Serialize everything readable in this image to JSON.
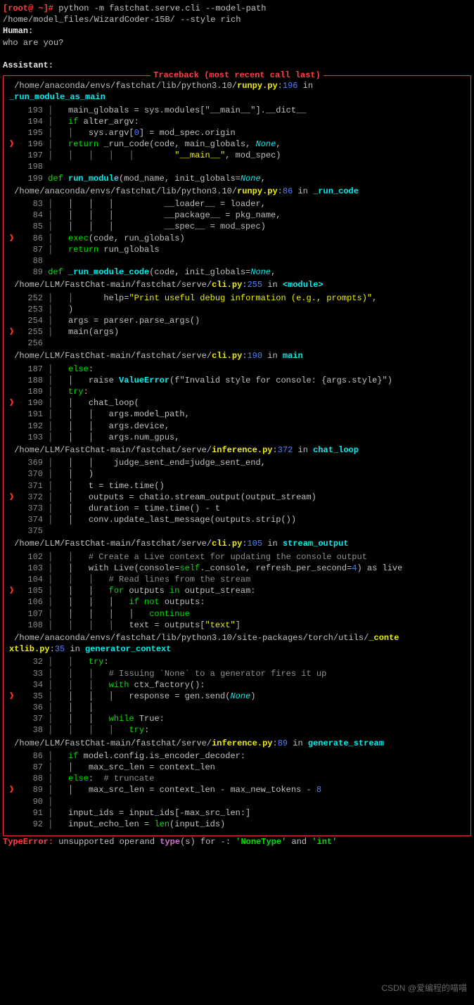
{
  "prompt": {
    "user_host": "[root@ ~]#",
    "cmd1": " python -m fastchat.serve.cli --model-path",
    "cmd2": "/home/model_files/WizardCoder-15B/ --style rich"
  },
  "labels": {
    "human": "Human:",
    "assistant": "Assistant:"
  },
  "human_input": "who are you?",
  "tb_title": "Traceback (most recent call last)",
  "loc1": {
    "path": "/home/anaconda/envs/fastchat/lib/python3.10/",
    "file": "runpy.py",
    "line": "196",
    "in": " in",
    "fn": "_run_module_as_main"
  },
  "code1": {
    "l193": "   main_globals = sys.modules[\"__main__\"].__dict__",
    "l194": "   if alter_argv:",
    "l195": "   │   sys.argv[0] = mod_spec.origin",
    "l196": "   return _run_code(code, main_globals, None,",
    "l197": "   │   │   │   │        \"__main__\", mod_spec)",
    "l198": "",
    "l199_a": "def ",
    "l199_b": "run_module",
    "l199_c": "(mod_name, init_globals=",
    "l199_d": "None",
    "l199_e": ","
  },
  "loc2": {
    "path": "/home/anaconda/envs/fastchat/lib/python3.10/",
    "file": "runpy.py",
    "line": "86",
    "in": " in ",
    "fn": "_run_code"
  },
  "code2": {
    "l83": "   │   │   │          __loader__ = loader,",
    "l84": "   │   │   │          __package__ = pkg_name,",
    "l85": "   │   │   │          __spec__ = mod_spec)",
    "l86": "   exec(code, run_globals)",
    "l87": "   return run_globals",
    "l88": "",
    "l89_a": "def ",
    "l89_b": "_run_module_code",
    "l89_c": "(code, init_globals=",
    "l89_d": "None",
    "l89_e": ","
  },
  "loc3": {
    "path": "/home/LLM/FastChat-main/fastchat/serve/",
    "file": "cli.py",
    "line": "255",
    "in": " in ",
    "fn": "<module>"
  },
  "code3": {
    "l252": "   │      help=\"Print useful debug information (e.g., prompts)\",",
    "l253": "   )",
    "l254": "   args = parser.parse_args()",
    "l255": "   main(args)",
    "l256": ""
  },
  "loc4": {
    "path": "/home/LLM/FastChat-main/fastchat/serve/",
    "file": "cli.py",
    "line": "190",
    "in": " in ",
    "fn": "main"
  },
  "code4": {
    "l187": "   else:",
    "l188a": "   │   raise ",
    "l188b": "ValueError",
    "l188c": "(f\"Invalid style for console: {args.style}\")",
    "l189": "   try:",
    "l190": "   │   chat_loop(",
    "l191": "   │   │   args.model_path,",
    "l192": "   │   │   args.device,",
    "l193": "   │   │   args.num_gpus,"
  },
  "loc5": {
    "path": "/home/LLM/FastChat-main/fastchat/serve/",
    "file": "inference.py",
    "line": "372",
    "in": " in ",
    "fn": "chat_loop"
  },
  "code5": {
    "l369": "   │   │    judge_sent_end=judge_sent_end,",
    "l370": "   │   )",
    "l371": "   │   t = time.time()",
    "l372": "   │   outputs = chatio.stream_output(output_stream)",
    "l373": "   │   duration = time.time() - t",
    "l374": "   │   conv.update_last_message(outputs.strip())",
    "l375": ""
  },
  "loc6": {
    "path": "/home/LLM/FastChat-main/fastchat/serve/",
    "file": "cli.py",
    "line": "105",
    "in": " in ",
    "fn": "stream_output"
  },
  "code6": {
    "l102": "   │   # Create a Live context for updating the console output",
    "l103a": "   │   with Live(console=",
    "l103b": "self",
    "l103c": "._console, refresh_per_second=",
    "l103d": "4",
    "l103e": ") as live",
    "l104": "   │   │   # Read lines from the stream",
    "l105a": "   │   │   ",
    "l105b": "for",
    "l105c": " outputs ",
    "l105d": "in",
    "l105e": " output_stream:",
    "l106a": "   │   │   │   ",
    "l106b": "if not",
    "l106c": " outputs:",
    "l107a": "   │   │   │   │   ",
    "l107b": "continue",
    "l108": "   │   │   │   text = outputs[\"text\"]"
  },
  "loc7": {
    "path": "/home/anaconda/envs/fastchat/lib/python3.10/site-packages/torch/utils/",
    "file": "_contextlib.py",
    "line": "35",
    "in": " in ",
    "fn": "generator_context"
  },
  "code7": {
    "l32": "   │   try:",
    "l33": "   │   │   # Issuing `None` to a generator fires it up",
    "l34": "   │   │   with ctx_factory():",
    "l35a": "   │   │   │   response = gen.send(",
    "l35b": "None",
    "l35c": ")",
    "l36": "   │   │   ",
    "l37a": "   │   │   ",
    "l37b": "while",
    "l37c": " True:",
    "l38": "   │   │   │   try:"
  },
  "loc8": {
    "path": "/home/LLM/FastChat-main/fastchat/serve/",
    "file": "inference.py",
    "line": "89",
    "in": " in ",
    "fn": "generate_stream"
  },
  "code8": {
    "l86": "   if model.config.is_encoder_decoder:",
    "l87": "   │   max_src_len = context_len",
    "l88a": "   else:  ",
    "l88b": "# truncate",
    "l89a": "   │   max_src_len = context_len - max_new_tokens - ",
    "l89b": "8",
    "l90": "",
    "l91a": "   input_ids = input_ids[-max_src_len:]",
    "l92a": "   input_echo_len = ",
    "l92b": "len",
    "l92c": "(input_ids)"
  },
  "err": {
    "type": "TypeError:",
    "msg1": " unsupported operand ",
    "type2": "type",
    "msg2": "(s) for -: ",
    "t1": "'NoneType'",
    "and": " and ",
    "t2": "'int'"
  },
  "watermark": "CSDN @爱编程的喵喵"
}
